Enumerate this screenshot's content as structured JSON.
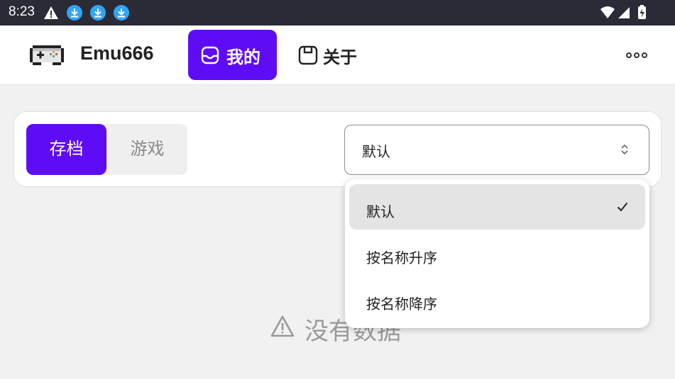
{
  "status_bar": {
    "time": "8:23",
    "icons": [
      "warning-icon",
      "download-icon",
      "download-icon",
      "download-icon",
      "wifi-icon",
      "signal-icon",
      "battery-icon"
    ]
  },
  "app_bar": {
    "title": "Emu666",
    "nav": {
      "mine_label": "我的",
      "about_label": "关于"
    },
    "accent_color": "#5e0cf6"
  },
  "filter_card": {
    "segments": {
      "active_label": "存档",
      "inactive_label": "游戏"
    },
    "sort_select": {
      "value": "默认"
    }
  },
  "sort_menu": {
    "options": [
      {
        "label": "默认",
        "selected": true
      },
      {
        "label": "按名称升序",
        "selected": false
      },
      {
        "label": "按名称降序",
        "selected": false
      }
    ]
  },
  "empty_state": {
    "text": "没有数据"
  }
}
